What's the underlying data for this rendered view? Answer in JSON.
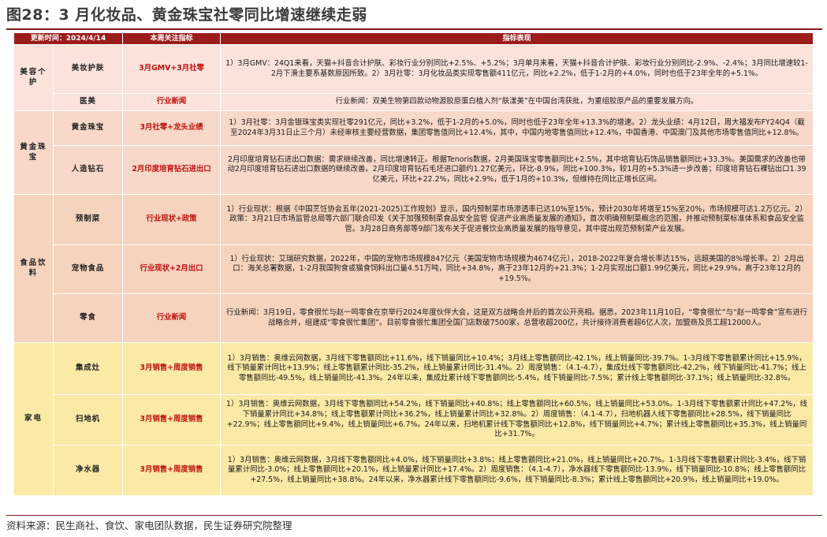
{
  "figure_title": "图28：3 月化妆品、黄金珠宝社零同比增速继续走弱",
  "header": {
    "update_time": "更新时间：2024/4/14",
    "focus_indicator": "本周关注指标",
    "performance": "指标表现"
  },
  "groups": [
    {
      "category": "美容个护",
      "rows": [
        {
          "sub": "美妆护肤",
          "focus": "3月GMV+3月社零",
          "text": "1）3月GMV：24Q1来看，天猫+抖音合计护肤、彩妆行业分别同比+2.5%、+5.2%；3月单月来看，天猫+抖音合计护肤、彩妆行业分别同比-2.9%、-2.4%；3月同比增速较1-2月下滑主要系基数原因所致。2）3月社零：3月化妆品类实现零售额411亿元，同比+2.2%，低于1-2月的+4.0%，同时也低于23年全年的+5.1%。"
        },
        {
          "sub": "医美",
          "focus": "行业新闻",
          "text": "行业新闻：双美生物第四款动物源胶原蛋白植入剂“肤漾美”在中国台湾获批，为重组胶原产品的重要发展方向。"
        }
      ]
    },
    {
      "category": "黄金珠宝",
      "rows": [
        {
          "sub": "黄金珠宝",
          "focus": "3月社零+龙头业绩",
          "text": "1）3月社零：3月金银珠宝类实现社零291亿元，同比+3.2%，低于1-2月的+5.0%，同时也低于23年全年+13.3%的增速。2）龙头业绩：4月12日，周大福发布FY24Q4（截至2024年3月31日止三个月）未经审核主要经营数据，集团零售值同比+12.4%，其中，中国内地零售值同比+12.4%，中国香港、中国澳门及其他市场零售值同比+12.8%。"
        },
        {
          "sub": "人造钻石",
          "focus": "2月印度培育钻石进出口",
          "text": "2月印度培育钻石进出口数据：需求继续改善，同比增速转正。根据Tenoris数据，2月美国珠宝零售额同比+2.5%，其中培育钻石饰品销售额同比+33.3%。美国需求的改善也带动2月印度培育钻石进出口数据的继续改善。2月印度培育钻石毛坯进口额约1.27亿美元，环比-8.9%，同比+100.3%，较1月的+5.3%进一步改善；印度培育钻石裸钻出口1.39亿美元，环比+22.2%，同比+2.9%，低于1月的+10.3%，但维持在同比正增长区间。"
        }
      ]
    },
    {
      "category": "食品饮料",
      "rows": [
        {
          "sub": "预制菜",
          "focus": "行业现状+政策",
          "text": "1）行业现状：根据《中国烹饪协会五年(2021-2025)工作规划》显示，国内预制菜市场渗透率已达10%至15%，预计2030年将增至15%至20%，市场规模可达1.2万亿元。2）政策：3月21日市场监管总局等六部门联合印发《关于加强预制菜食品安全监管 促进产业高质量发展的通知》，首次明确预制菜概念的范围，并推动预制菜标准体系和食品安全监管。3月28日商务部等9部门发布关于促进餐饮业高质量发展的指导意见，其中提出规范预制菜产业发展。"
        },
        {
          "sub": "宠物食品",
          "focus": "行业现状+2月出口",
          "text": "1）行业现状：艾瑞研究数据，2022年，中国的宠物市场规模847亿元（美国宠物市场规模为4674亿元），2018-2022年复合增长率达15%，远超美国的8%增长率。2）2月出口：海关总署数据，1-2月我国狗食或猫食饲料出口量4.51万吨，同比+34.8%，高于23年12月的+21.3%；1-2月实现出口额1.99亿美元，同比+29.9%，高于23年12月的+19.5%。"
        },
        {
          "sub": "零食",
          "focus": "行业新闻",
          "text": "行业新闻：3月19日，零食很忙与赵一鸣零食在京举行2024年度伙伴大会，这是双方战略合并后的首次公开亮相。据悉，2023年11月10日，“零食很忙”与“赵一鸣零食”宣布进行战略合并，组建成“零食很忙集团”。目前零食很忙集团全国门店数破7500家，总营收超200亿，共计接待消费者超6亿人次，加盟商及员工超12000人。"
        }
      ]
    },
    {
      "category": "家电",
      "rows": [
        {
          "sub": "集成灶",
          "focus": "3月销售+周度销售",
          "text": "1）3月销售：奥维云网数据，3月线下零售额同比+11.6%，线下销量同比+10.4%；3月线上零售额同比-42.1%，线上销量同比-39.7%。1-3月线下零售额累计同比+15.9%，线下销量累计同比+13.9%；线上零售额累计同比-35.2%，线上销量累计同比-31.4%。2）周度销售：（4.1-4.7），集成灶线下零售额同比-42.2%，线下销量同比-41.7%；线上零售额同比-49.5%，线上销量同比-41.3%。24年以来，集成灶累计线下零售额同比-5.4%，线下销量同比-7.5%；累计线上零售额同比-37.1%；线上销量同比-32.8%。"
        },
        {
          "sub": "扫地机",
          "focus": "3月销售+周度销售",
          "text": "1）3月销售：奥维云网数据，3月线下零售额同比+54.2%，线下销量同比+40.8%；线上零售额同比+60.5%，线上销量同比+53.0%。1-3月线下零售额累计同比+47.2%，线下销量累计同比+34.8%；线上零售额累计同比+36.2%，线上销量累计同比+32.8%。2）周度销售：（4.1-4.7），扫地机器人线下零售额同比+28.5%，线下销量同比+22.9%；线上零售额同比+9.4%，线上销量同比+6.7%。24年以来，扫地机累计线下零售额同比+12.8%，线下销量同比+4.7%；累计线上零售额同比+35.3%，线上销量同比+31.7%。"
        },
        {
          "sub": "净水器",
          "focus": "3月销售+周度销售",
          "text": "1）3月销售：奥维云网数据，3月线下零售额同比+4.0%，线下销量同比+3.8%；线上零售额同比+21.0%，线上销量同比+20.7%。1-3月线下零售额累计同比-3.4%，线下销量累计同比-3.0%；线上零售额同比+20.1%，线上销量累计同比+17.4%。2）周度销售：（4.1-4.7），净水器线下零售额同比-13.9%，线下销量同比-10.8%；线上零售额同比+27.5%，线上销量同比+38.8%。24年以来，净水器累计线下零售额同比-9.6%，线下销量同比-8.3%；累计线上零售额同比+20.9%，线上销量同比+19.0%。"
        }
      ]
    }
  ],
  "source": "资料来源：民生商社、食饮、家电团队数据，民生证券研究院整理"
}
